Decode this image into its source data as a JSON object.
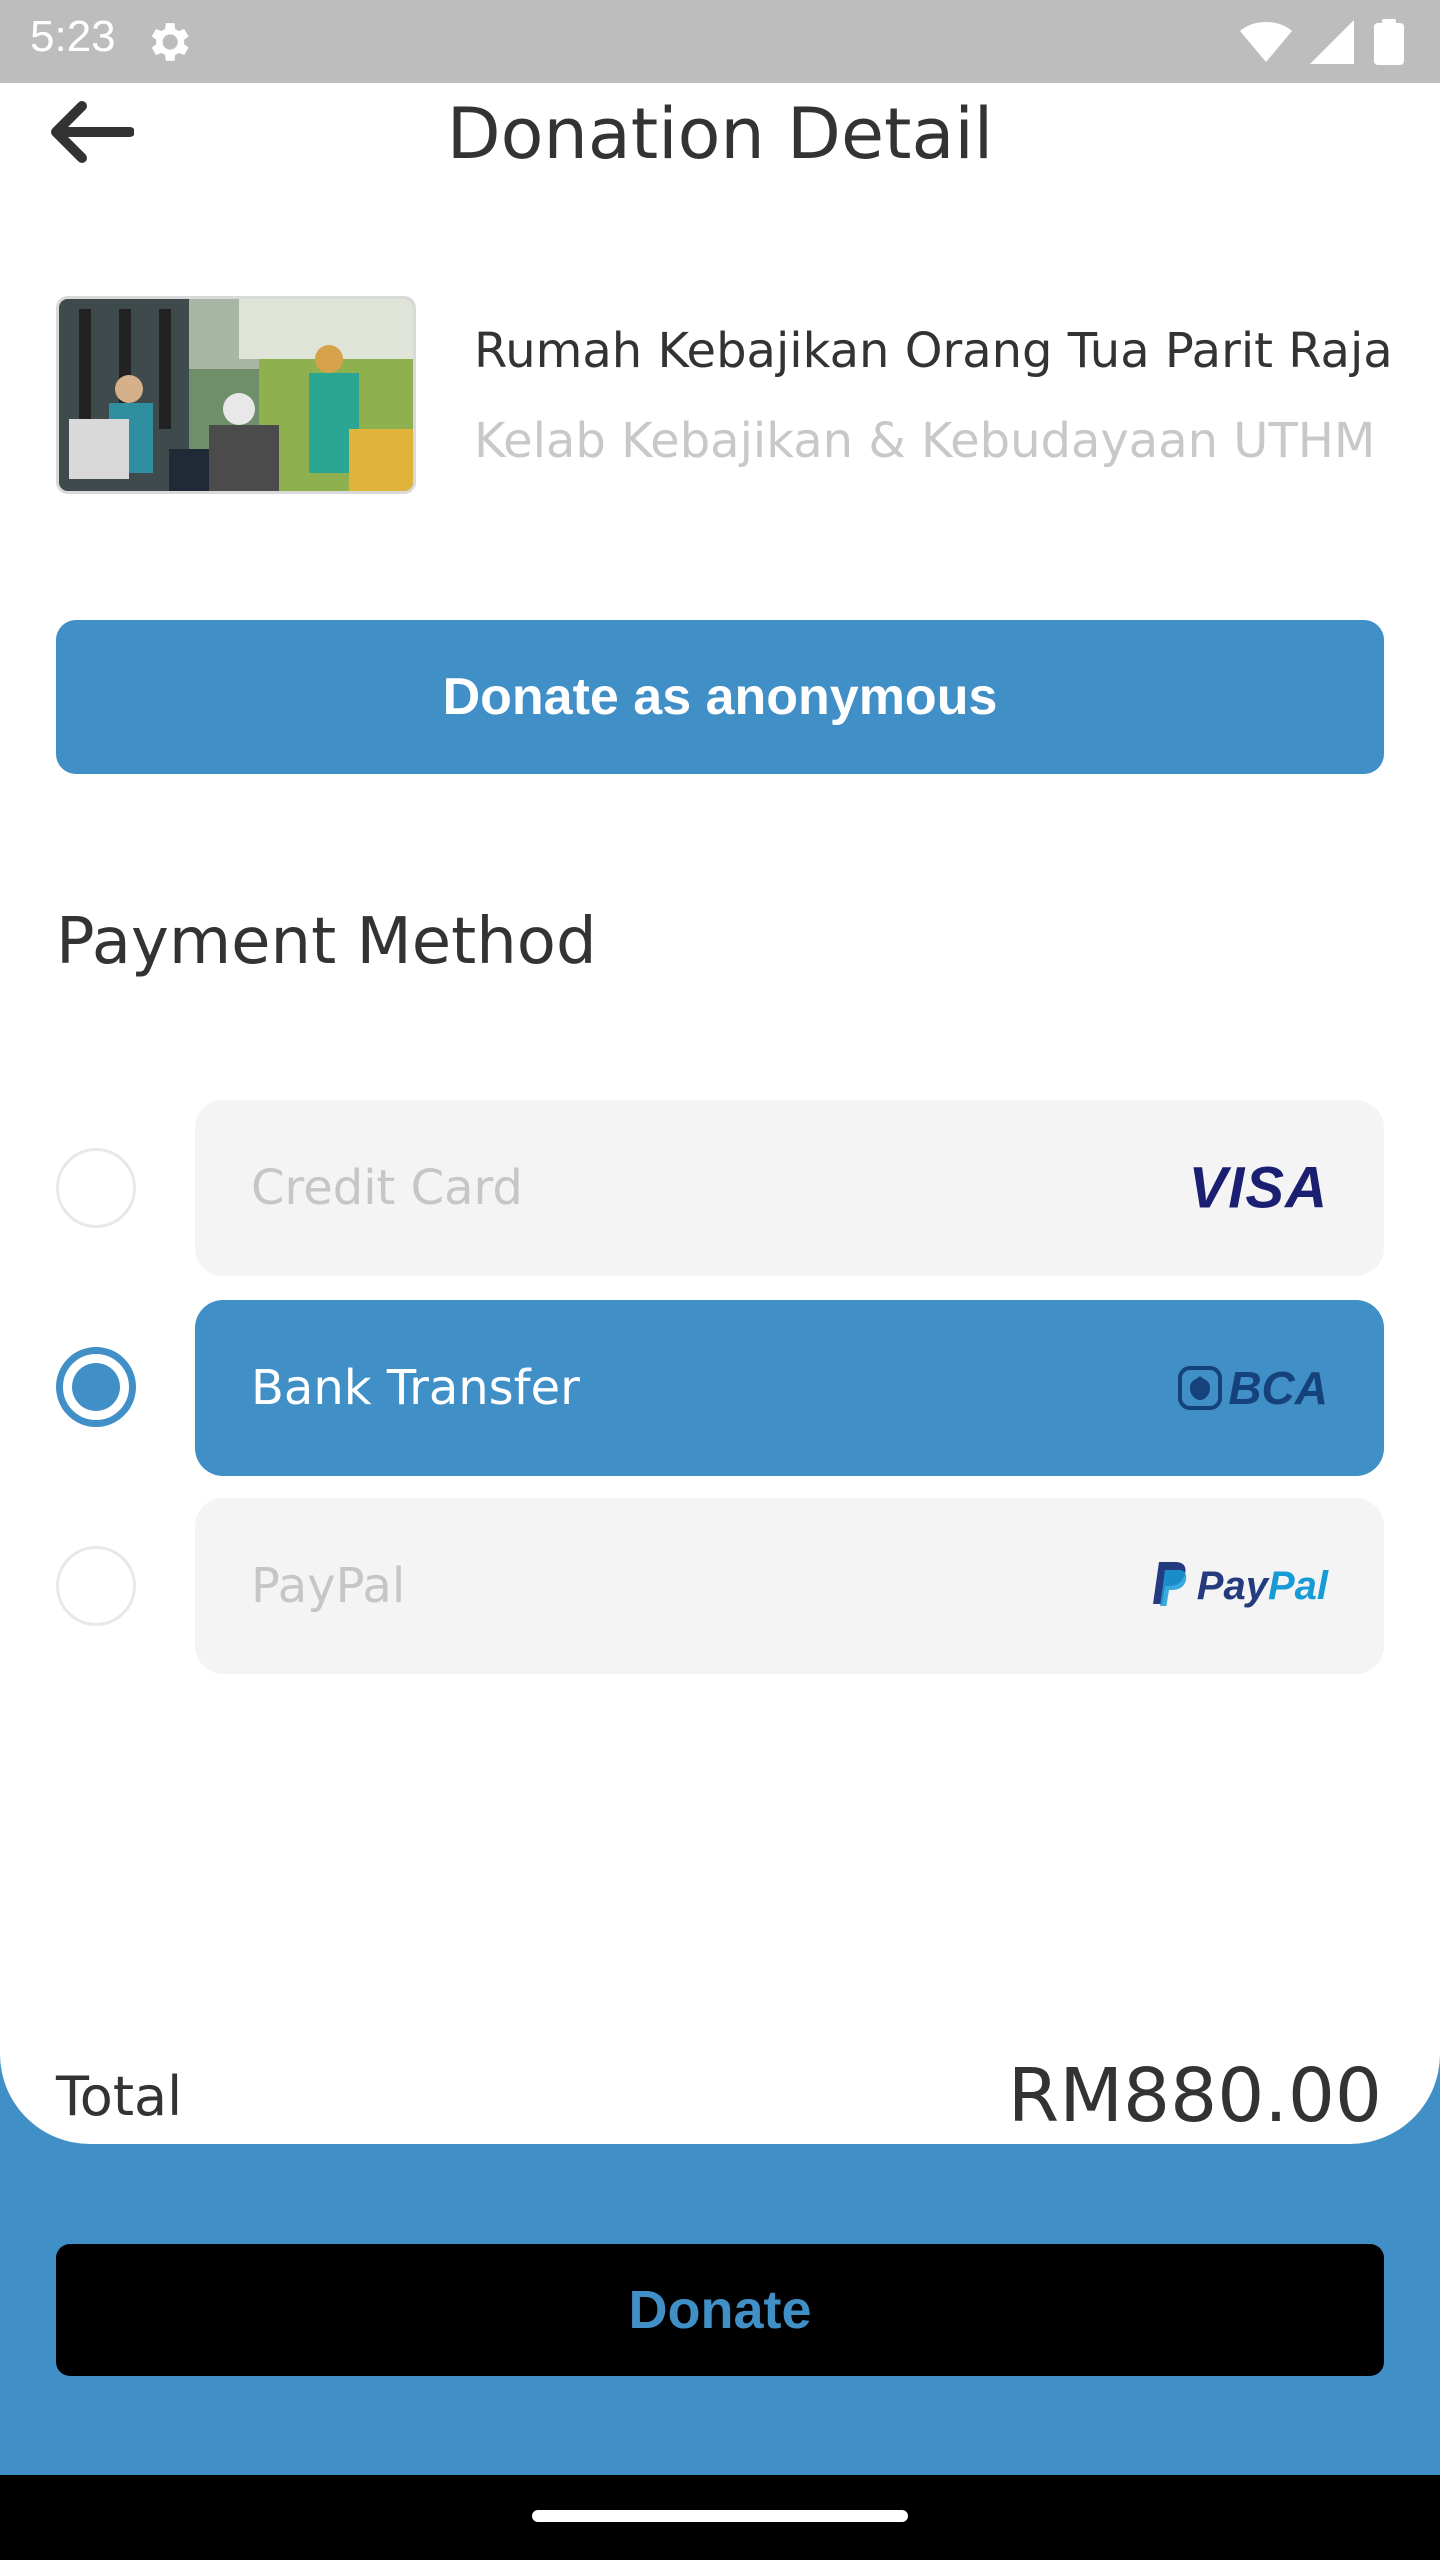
{
  "status_bar": {
    "time": "5:23",
    "icons": [
      "settings-gear-icon",
      "wifi-icon",
      "signal-icon",
      "battery-icon"
    ]
  },
  "header": {
    "title": "Donation Detail",
    "back_icon": "arrow-left-icon"
  },
  "campaign": {
    "title": "Rumah Kebajikan Orang Tua Parit Raja",
    "organizer": "Kelab Kebajikan & Kebudayaan UTHM"
  },
  "anonymous_button": {
    "label": "Donate as anonymous"
  },
  "payment": {
    "heading": "Payment Method",
    "selected": "Bank Transfer",
    "options": [
      {
        "label": "Credit Card",
        "logo_text": "VISA",
        "selected": false
      },
      {
        "label": "Bank Transfer",
        "logo_text": "BCA",
        "selected": true
      },
      {
        "label": "PayPal",
        "logo_text": "PayPal",
        "selected": false
      }
    ]
  },
  "total": {
    "label": "Total",
    "amount": "RM880.00"
  },
  "donate_button": {
    "label": "Donate"
  },
  "colors": {
    "accent": "#418fc7",
    "text": "#333333",
    "muted": "#c6c6c6",
    "option_bg": "#f4f4f4",
    "visa_blue": "#1a1f71",
    "paypal_dark": "#253b80",
    "paypal_light": "#179bd7"
  }
}
